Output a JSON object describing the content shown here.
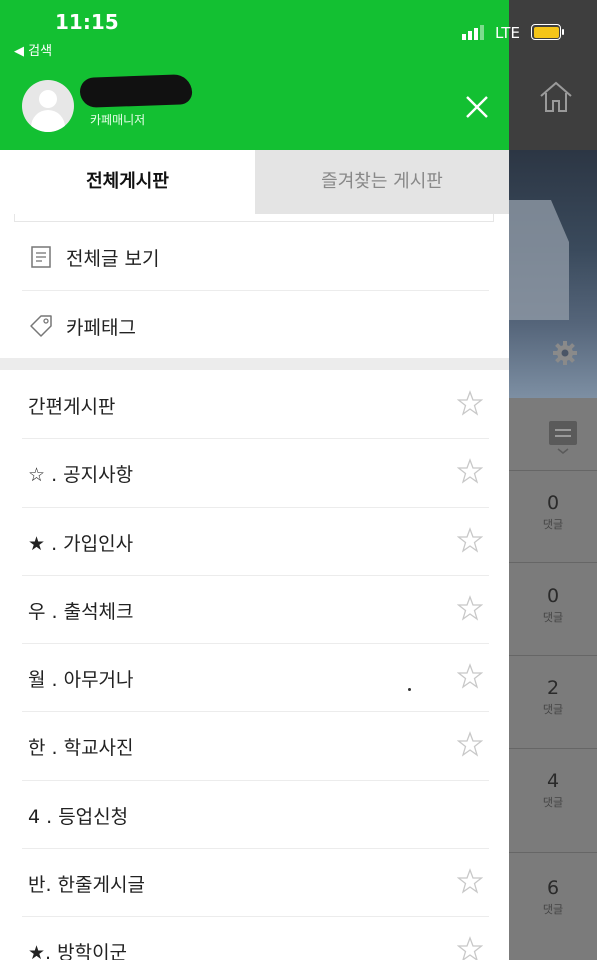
{
  "status_bar": {
    "time": "11:15",
    "back_label": "◀ 검색",
    "network": "LTE",
    "battery_color": "#f5c518"
  },
  "drawer": {
    "header_color": "#13c032",
    "user_role": "카페매니저",
    "close_icon": "close-icon"
  },
  "tabs": [
    {
      "label": "전체게시판",
      "active": true
    },
    {
      "label": "즐겨찾는 게시판",
      "active": false
    }
  ],
  "menu": [
    {
      "label": "전체글 보기",
      "icon": "document-icon"
    },
    {
      "label": "카페태그",
      "icon": "tag-icon"
    }
  ],
  "boards": [
    {
      "label": "간편게시판",
      "star": true
    },
    {
      "label": "☆ . 공지사항",
      "star": true
    },
    {
      "label": "★ . 가입인사",
      "star": true
    },
    {
      "label": "우 . 출석체크",
      "star": true
    },
    {
      "label": "월 . 아무거나",
      "star": true
    },
    {
      "label": "한 . 학교사진",
      "star": true
    },
    {
      "label": "4 . 등업신청",
      "star": false
    },
    {
      "label": "반.  한줄게시글",
      "star": true
    },
    {
      "label": "★.  방학이군",
      "star": true
    }
  ],
  "background": {
    "comment_counts": [
      {
        "count": "0",
        "label": "댓글"
      },
      {
        "count": "0",
        "label": "댓글"
      },
      {
        "count": "2",
        "label": "댓글"
      },
      {
        "count": "4",
        "label": "댓글"
      },
      {
        "count": "6",
        "label": "댓글"
      }
    ]
  }
}
